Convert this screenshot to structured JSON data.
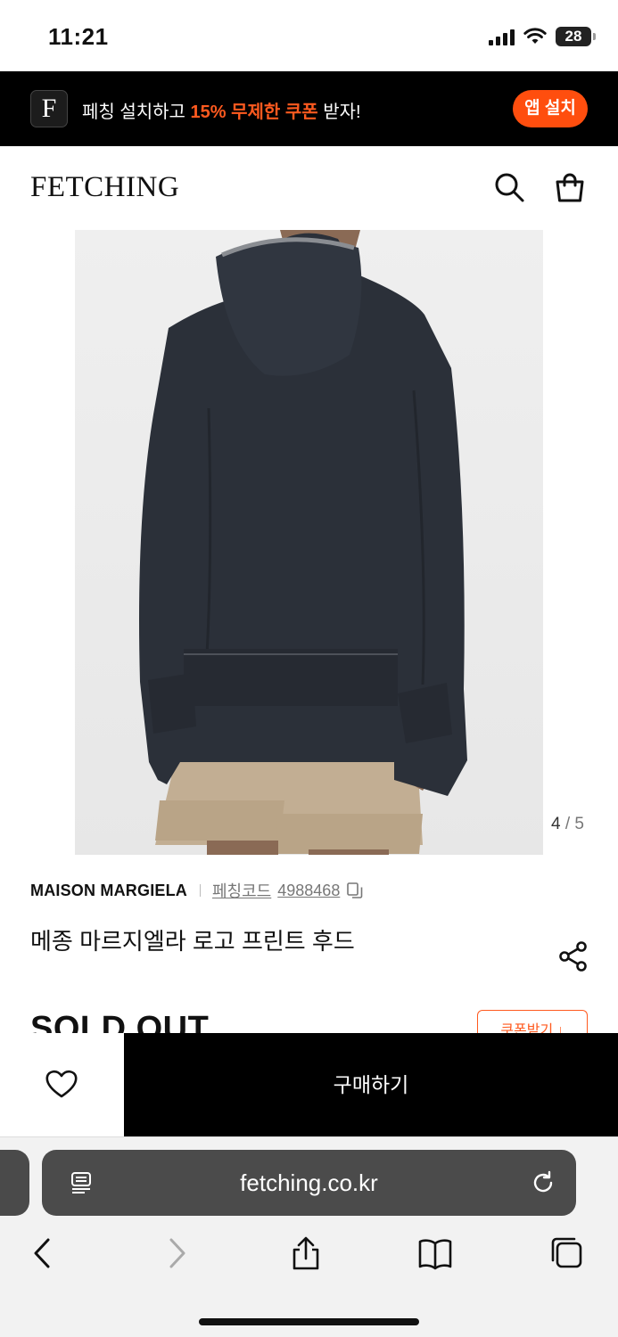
{
  "status_bar": {
    "time": "11:21",
    "battery": "28"
  },
  "promo": {
    "logo_letter": "F",
    "text_before": "페칭 설치하고 ",
    "text_highlight": "15% 무제한 쿠폰",
    "text_after": " 받자!",
    "highlight_color": "#ff5a1f",
    "button_label": "앱 설치"
  },
  "header": {
    "logo": "FETCHING",
    "icons": [
      "search-icon",
      "shopping-bag-icon"
    ]
  },
  "product": {
    "image_alt": "hoodie-back-view",
    "image_index": "4",
    "image_separator": "/",
    "image_total": "5",
    "brand": "MAISON MARGIELA",
    "code_label": "페칭코드",
    "code_value": "4988468",
    "name": "메종 마르지엘라 로고 프린트 후드",
    "status": "SOLD OUT",
    "coupon_label": "쿠폰받기 ↓"
  },
  "purchase_bar": {
    "buy_label": "구매하기"
  },
  "browser": {
    "url": "fetching.co.kr",
    "toolbar": [
      "back-icon",
      "forward-icon",
      "share-icon",
      "bookmarks-icon",
      "tabs-icon"
    ]
  },
  "colors": {
    "accent": "#ff4e0e",
    "banner_bg": "#000000",
    "buy_bg": "#000000"
  }
}
